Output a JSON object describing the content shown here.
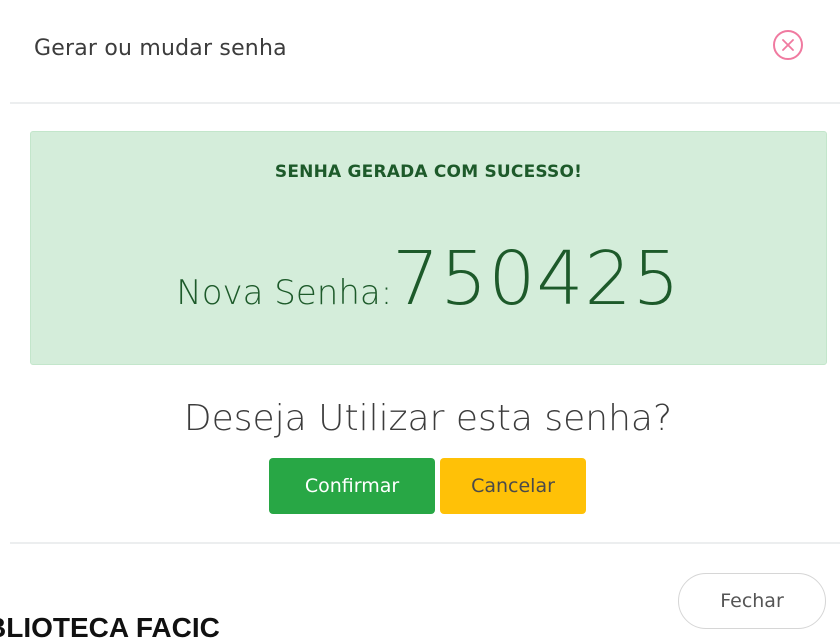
{
  "modal": {
    "title": "Gerar ou mudar senha",
    "close_icon": "close-circle-icon"
  },
  "alert": {
    "heading": "SENHA GERADA COM SUCESSO!",
    "password_label": "Nova Senha:",
    "password_value": "750425",
    "background_color": "#d4edda",
    "text_color": "#1d5a2a"
  },
  "prompt": {
    "question": "Deseja Utilizar esta senha?",
    "confirm_label": "Confirmar",
    "cancel_label": "Cancelar",
    "confirm_color": "#28a745",
    "cancel_color": "#ffc107"
  },
  "footer": {
    "close_label": "Fechar"
  },
  "background": {
    "partial_text": "BLIOTECA FACIC"
  }
}
